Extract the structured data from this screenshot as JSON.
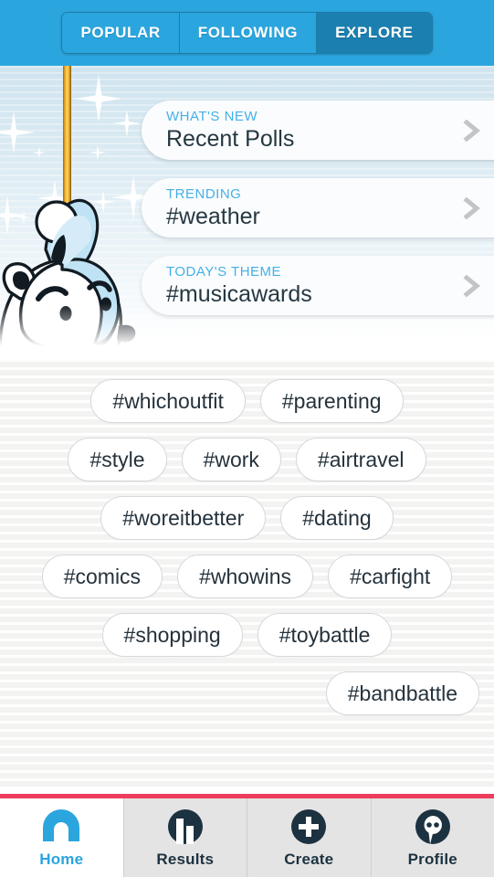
{
  "header": {
    "tabs": [
      {
        "label": "POPULAR",
        "active": false
      },
      {
        "label": "FOLLOWING",
        "active": false
      },
      {
        "label": "EXPLORE",
        "active": true
      }
    ]
  },
  "hero": {
    "mascot": "polar-bear-mascot",
    "cards": [
      {
        "label": "WHAT'S NEW",
        "title": "Recent Polls",
        "chevron": "chevron-right-icon"
      },
      {
        "label": "TRENDING",
        "title": "#weather",
        "chevron": "chevron-right-icon"
      },
      {
        "label": "TODAY'S THEME",
        "title": "#musicawards",
        "chevron": "chevron-right-icon"
      }
    ]
  },
  "tags": {
    "rows": [
      [
        "#whichoutfit",
        "#parenting"
      ],
      [
        "#style",
        "#work",
        "#airtravel"
      ],
      [
        "#woreitbetter",
        "#dating"
      ],
      [
        "#comics",
        "#whowins",
        "#carfight"
      ],
      [
        "#shopping",
        "#toybattle"
      ],
      [
        "#bandbattle"
      ]
    ]
  },
  "bottom_nav": {
    "items": [
      {
        "label": "Home",
        "icon": "home-arch-icon",
        "active": true
      },
      {
        "label": "Results",
        "icon": "bar-chart-icon",
        "active": false
      },
      {
        "label": "Create",
        "icon": "plus-circle-icon",
        "active": false
      },
      {
        "label": "Profile",
        "icon": "speech-bubble-icon",
        "active": false
      }
    ]
  },
  "colors": {
    "header_blue": "#2ba5de",
    "header_blue_active": "#1b7fb0",
    "accent_red": "#ee3d5c",
    "card_label_blue": "#44b0e8",
    "dark_navy": "#1d3240"
  }
}
